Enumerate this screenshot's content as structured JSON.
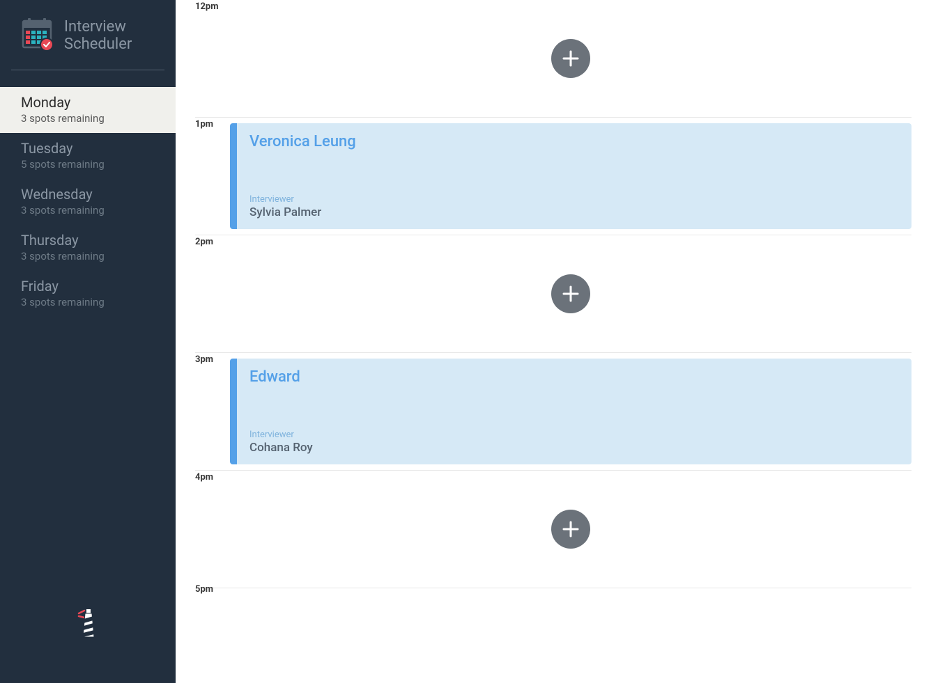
{
  "app": {
    "title_line1": "Interview",
    "title_line2": "Scheduler"
  },
  "sidebar": {
    "days": [
      {
        "name": "Monday",
        "spots": "3 spots remaining",
        "selected": true
      },
      {
        "name": "Tuesday",
        "spots": "5 spots remaining",
        "selected": false
      },
      {
        "name": "Wednesday",
        "spots": "3 spots remaining",
        "selected": false
      },
      {
        "name": "Thursday",
        "spots": "3 spots remaining",
        "selected": false
      },
      {
        "name": "Friday",
        "spots": "3 spots remaining",
        "selected": false
      }
    ]
  },
  "labels": {
    "interviewer": "Interviewer"
  },
  "schedule": {
    "slots": [
      {
        "time": "12pm",
        "type": "empty"
      },
      {
        "time": "1pm",
        "type": "appointment",
        "student": "Veronica Leung",
        "interviewer": "Sylvia Palmer"
      },
      {
        "time": "2pm",
        "type": "empty"
      },
      {
        "time": "3pm",
        "type": "appointment",
        "student": "Edward",
        "interviewer": "Cohana Roy"
      },
      {
        "time": "4pm",
        "type": "empty"
      },
      {
        "time": "5pm",
        "type": "separator"
      }
    ]
  }
}
